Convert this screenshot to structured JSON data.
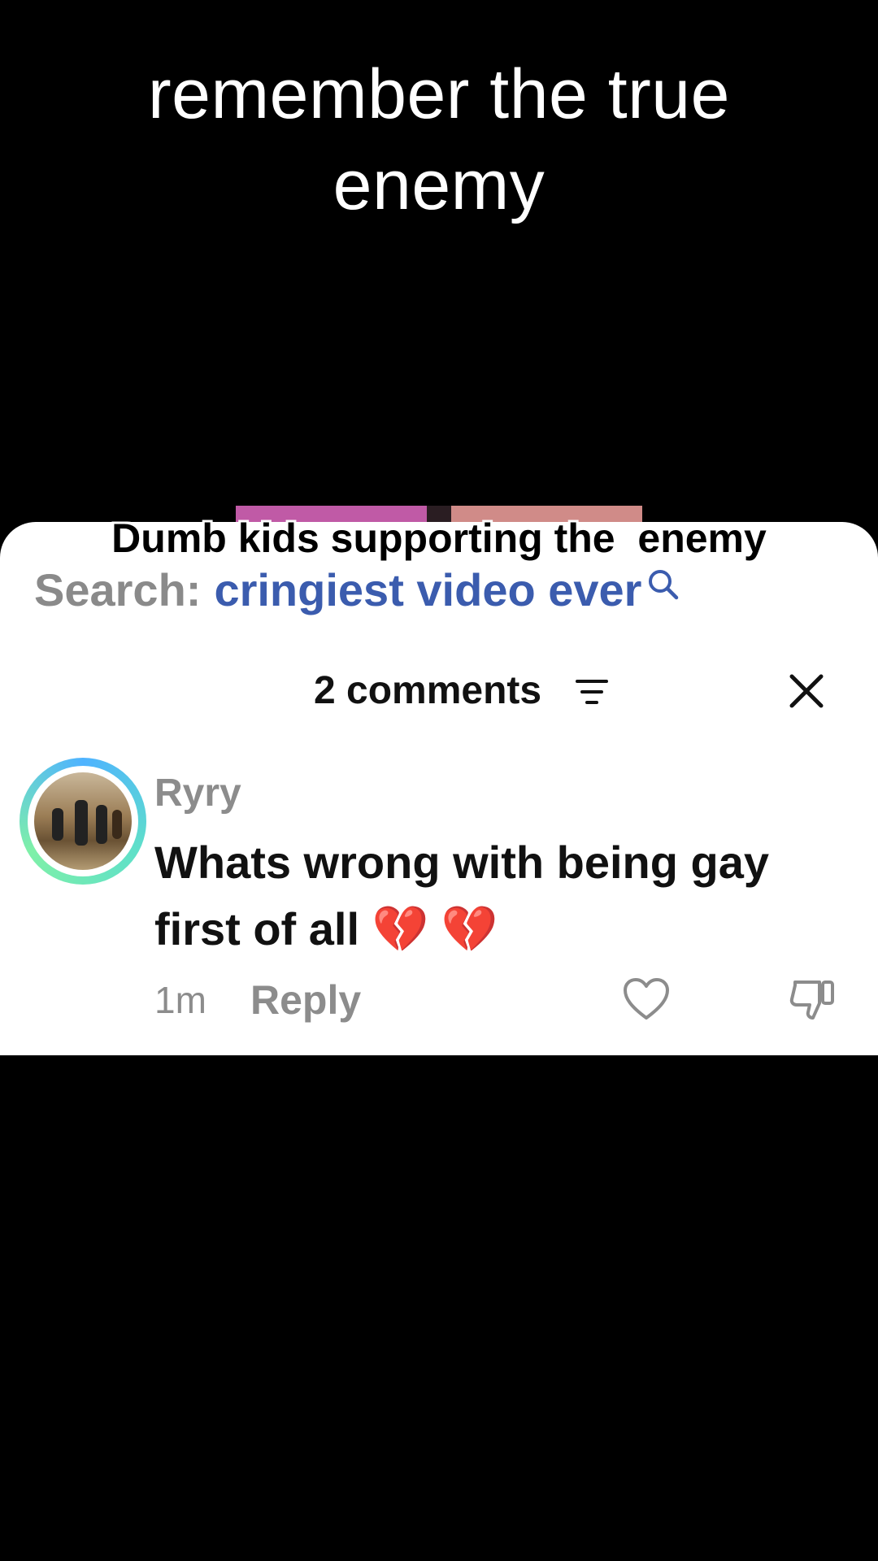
{
  "video": {
    "overlay_caption_line1": "remember the true",
    "overlay_caption_line2": "enemy",
    "subtitle": "Dumb kids supporting the  enemy"
  },
  "search": {
    "prefix": "Search:",
    "query": "cringiest video ever",
    "icon": "search-icon"
  },
  "comments_panel": {
    "title": "2 comments",
    "sort_icon": "sort-icon",
    "close_icon": "close-icon",
    "comments": [
      {
        "username": "Ryry",
        "text_line1": "Whats wrong with being gay",
        "text_line2": "first of all 💔 💔",
        "time": "1m",
        "reply_label": "Reply",
        "like_icon": "heart-icon",
        "dislike_icon": "thumbs-down-icon"
      }
    ]
  },
  "colors": {
    "background": "#000000",
    "sheet": "#ffffff",
    "search_query": "#3b5cae",
    "muted_text": "#8c8c8c",
    "avatar_ring_start": "#4fb3ff",
    "avatar_ring_end": "#7ff0a8"
  }
}
